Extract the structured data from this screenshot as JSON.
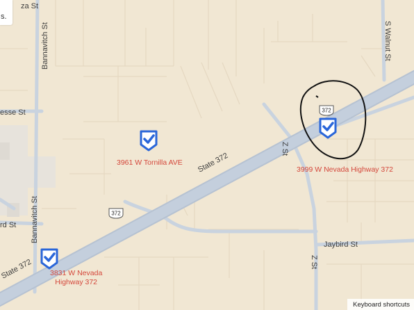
{
  "map": {
    "corner_text_top": "s.",
    "corner_text_partial": "",
    "keyboard_shortcuts": "Keyboard shortcuts",
    "colors": {
      "land": "#f1e7d3",
      "road": "#c9d3df",
      "road_edge": "#b8c3d1",
      "highway": "#c2cedd",
      "parcel_line": "#e6dac4",
      "pin": "#2a66d9",
      "label_red": "#d4473b",
      "circle": "#111111"
    },
    "streets": {
      "plaza": "za St",
      "bannavitch_top": "Bannavitch St",
      "bannavitch_bottom": "Bannavitch St",
      "cesse": "esse St",
      "rd": "rd St",
      "state": "State 372",
      "state_bottom": "State 372",
      "walnut": "S Walnut St",
      "z_upper": "Z St",
      "z_lower": "Z St",
      "jaybird": "Jaybird St"
    },
    "route_shields": [
      {
        "number": "372",
        "icon": "highway-shield-icon"
      },
      {
        "number": "372",
        "icon": "highway-shield-icon"
      }
    ],
    "places": [
      {
        "label": "3961 W Tornilla AVE",
        "icon": "checkmark-pin-icon"
      },
      {
        "label": "3999 W Nevada Highway 372",
        "icon": "checkmark-pin-icon"
      },
      {
        "label_line1": "3831 W Nevada",
        "label_line2": "Highway 372",
        "icon": "checkmark-pin-icon"
      }
    ]
  }
}
